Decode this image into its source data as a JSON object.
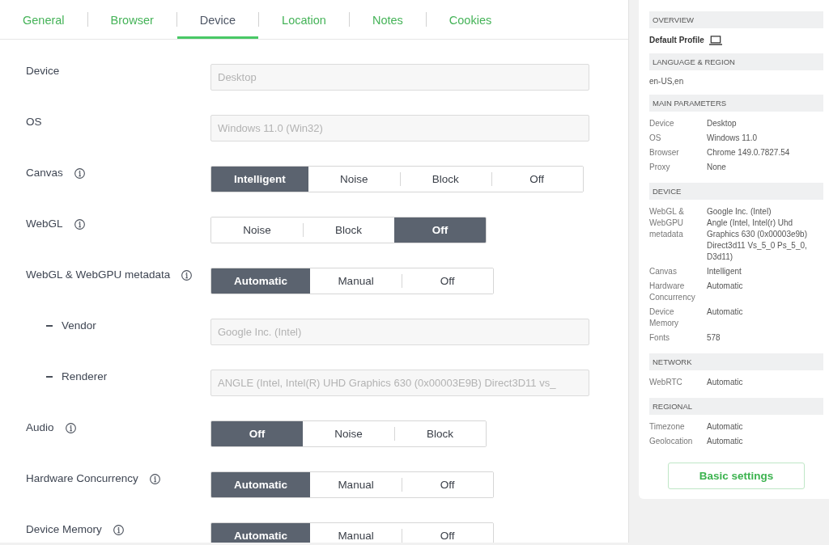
{
  "tabs": [
    {
      "label": "General",
      "selected": false
    },
    {
      "label": "Browser",
      "selected": false
    },
    {
      "label": "Device",
      "selected": true
    },
    {
      "label": "Location",
      "selected": false
    },
    {
      "label": "Notes",
      "selected": false
    },
    {
      "label": "Cookies",
      "selected": false
    }
  ],
  "settings": [
    {
      "kind": "field",
      "label": "Device",
      "value": "Desktop",
      "disabled": true
    },
    {
      "kind": "field",
      "label": "OS",
      "value": "Windows 11.0 (Win32)",
      "disabled": true
    },
    {
      "kind": "segmented",
      "label": "Canvas",
      "info": true,
      "options": [
        {
          "label": "Intelligent",
          "selected": true
        },
        {
          "label": "Noise",
          "selected": false
        },
        {
          "label": "Block",
          "selected": false
        },
        {
          "label": "Off",
          "selected": false
        }
      ]
    },
    {
      "kind": "segmented",
      "label": "WebGL",
      "info": true,
      "options": [
        {
          "label": "Noise",
          "selected": false
        },
        {
          "label": "Block",
          "selected": false
        },
        {
          "label": "Off",
          "selected": true
        }
      ]
    },
    {
      "kind": "segmented",
      "label": "WebGL & WebGPU metadata",
      "info": true,
      "options": [
        {
          "label": "Automatic",
          "selected": true
        },
        {
          "label": "Manual",
          "selected": false
        },
        {
          "label": "Off",
          "selected": false
        }
      ],
      "children": [
        {
          "kind": "field",
          "label": "Vendor",
          "value": "Google Inc. (Intel)",
          "disabled": true
        },
        {
          "kind": "field",
          "label": "Renderer",
          "value": "ANGLE (Intel, Intel(R) UHD Graphics 630 (0x00003E9B) Direct3D11 vs_",
          "disabled": true
        }
      ]
    },
    {
      "kind": "segmented",
      "label": "Audio",
      "info": true,
      "options": [
        {
          "label": "Off",
          "selected": true
        },
        {
          "label": "Noise",
          "selected": false
        },
        {
          "label": "Block",
          "selected": false
        }
      ]
    },
    {
      "kind": "segmented",
      "label": "Hardware Concurrency",
      "info": true,
      "options": [
        {
          "label": "Automatic",
          "selected": true
        },
        {
          "label": "Manual",
          "selected": false
        },
        {
          "label": "Off",
          "selected": false
        }
      ]
    },
    {
      "kind": "segmented",
      "label": "Device Memory",
      "info": true,
      "options": [
        {
          "label": "Automatic",
          "selected": true
        },
        {
          "label": "Manual",
          "selected": false
        },
        {
          "label": "Off",
          "selected": false
        }
      ]
    }
  ],
  "overview": {
    "sections": [
      {
        "title": "OVERVIEW",
        "kind": "profile",
        "text": "Default Profile"
      },
      {
        "title": "LANGUAGE & REGION",
        "kind": "text",
        "text": "en-US,en"
      },
      {
        "title": "MAIN PARAMETERS",
        "kind": "params",
        "rows": [
          {
            "key": "Device",
            "lines": [
              "Desktop"
            ]
          },
          {
            "key": "OS",
            "lines": [
              "Windows 11.0"
            ]
          },
          {
            "key": "Browser",
            "lines": [
              "Chrome 149.0.7827.54"
            ]
          },
          {
            "key": "Proxy",
            "lines": [
              "None"
            ]
          }
        ]
      },
      {
        "title": "DEVICE",
        "kind": "params",
        "rows": [
          {
            "key": "WebGL & WebGPU metadata",
            "lines": [
              "Google Inc. (Intel)",
              "Angle (Intel, Intel(r) Uhd Graphics 630 (0x00003e9b) Direct3d11 Vs_5_0 Ps_5_0, D3d11)"
            ]
          },
          {
            "key": "Canvas",
            "lines": [
              "Intelligent"
            ]
          },
          {
            "key": "Hardware Concurrency",
            "lines": [
              "Automatic"
            ]
          },
          {
            "key": "Device Memory",
            "lines": [
              "Automatic"
            ]
          },
          {
            "key": "Fonts",
            "lines": [
              "578"
            ]
          }
        ]
      },
      {
        "title": "NETWORK",
        "kind": "params",
        "rows": [
          {
            "key": "WebRTC",
            "lines": [
              "Automatic"
            ]
          }
        ]
      },
      {
        "title": "REGIONAL",
        "kind": "params",
        "rows": [
          {
            "key": "Timezone",
            "lines": [
              "Automatic"
            ]
          },
          {
            "key": "Geolocation",
            "lines": [
              "Automatic"
            ]
          }
        ]
      }
    ],
    "button": "Basic settings"
  }
}
